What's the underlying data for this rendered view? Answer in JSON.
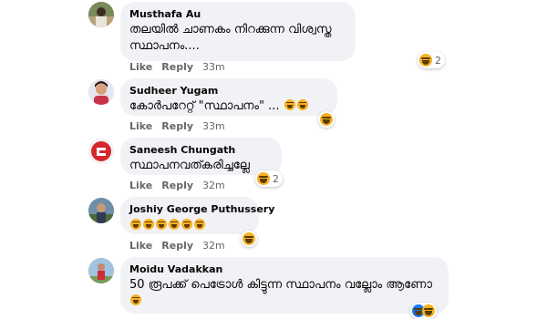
{
  "actions": {
    "like": "Like",
    "reply": "Reply"
  },
  "comments": [
    {
      "author": "Musthafa Au",
      "text": "തലയിൽ ചാണകം നിറക്കുന്ന വിശ്വസ്ത സ്ഥാപനം....",
      "time": "33m",
      "reaction_count": "2"
    },
    {
      "author": "Sudheer Yugam",
      "text": "കോർപറേറ്റ് \"സ്ഥാപനം\" ...",
      "time": "33m",
      "reaction_count": ""
    },
    {
      "author": "Saneesh Chungath",
      "text": "സ്ഥാപനവത്കരിച്ചല്ലേ",
      "time": "32m",
      "reaction_count": "2"
    },
    {
      "author": "Joshiy George Puthussery",
      "text": "",
      "time": "32m",
      "reaction_count": ""
    },
    {
      "author": "Moidu Vadakkan",
      "text": "50 രൂപക്ക് പെട്രോൾ കിട്ടുന്ന സ്ഥാപനം വല്ലോം ആണോ",
      "time": "",
      "reaction_count": ""
    }
  ],
  "icons": {
    "reaction": "haha-emoji-icon",
    "like": "like-reaction-icon"
  },
  "colors": {
    "haha": "#f7b125",
    "bubble": "#f0f2f5",
    "meta": "#65676b"
  }
}
